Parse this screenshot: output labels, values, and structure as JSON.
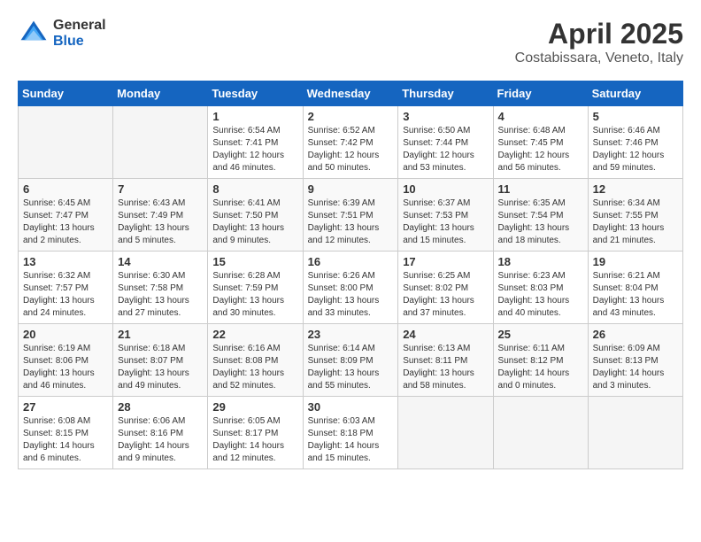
{
  "header": {
    "logo": {
      "general": "General",
      "blue": "Blue"
    },
    "title": "April 2025",
    "subtitle": "Costabissara, Veneto, Italy"
  },
  "weekdays": [
    "Sunday",
    "Monday",
    "Tuesday",
    "Wednesday",
    "Thursday",
    "Friday",
    "Saturday"
  ],
  "weeks": [
    [
      null,
      null,
      {
        "day": 1,
        "sunrise": "6:54 AM",
        "sunset": "7:41 PM",
        "daylight": "12 hours and 46 minutes."
      },
      {
        "day": 2,
        "sunrise": "6:52 AM",
        "sunset": "7:42 PM",
        "daylight": "12 hours and 50 minutes."
      },
      {
        "day": 3,
        "sunrise": "6:50 AM",
        "sunset": "7:44 PM",
        "daylight": "12 hours and 53 minutes."
      },
      {
        "day": 4,
        "sunrise": "6:48 AM",
        "sunset": "7:45 PM",
        "daylight": "12 hours and 56 minutes."
      },
      {
        "day": 5,
        "sunrise": "6:46 AM",
        "sunset": "7:46 PM",
        "daylight": "12 hours and 59 minutes."
      }
    ],
    [
      {
        "day": 6,
        "sunrise": "6:45 AM",
        "sunset": "7:47 PM",
        "daylight": "13 hours and 2 minutes."
      },
      {
        "day": 7,
        "sunrise": "6:43 AM",
        "sunset": "7:49 PM",
        "daylight": "13 hours and 5 minutes."
      },
      {
        "day": 8,
        "sunrise": "6:41 AM",
        "sunset": "7:50 PM",
        "daylight": "13 hours and 9 minutes."
      },
      {
        "day": 9,
        "sunrise": "6:39 AM",
        "sunset": "7:51 PM",
        "daylight": "13 hours and 12 minutes."
      },
      {
        "day": 10,
        "sunrise": "6:37 AM",
        "sunset": "7:53 PM",
        "daylight": "13 hours and 15 minutes."
      },
      {
        "day": 11,
        "sunrise": "6:35 AM",
        "sunset": "7:54 PM",
        "daylight": "13 hours and 18 minutes."
      },
      {
        "day": 12,
        "sunrise": "6:34 AM",
        "sunset": "7:55 PM",
        "daylight": "13 hours and 21 minutes."
      }
    ],
    [
      {
        "day": 13,
        "sunrise": "6:32 AM",
        "sunset": "7:57 PM",
        "daylight": "13 hours and 24 minutes."
      },
      {
        "day": 14,
        "sunrise": "6:30 AM",
        "sunset": "7:58 PM",
        "daylight": "13 hours and 27 minutes."
      },
      {
        "day": 15,
        "sunrise": "6:28 AM",
        "sunset": "7:59 PM",
        "daylight": "13 hours and 30 minutes."
      },
      {
        "day": 16,
        "sunrise": "6:26 AM",
        "sunset": "8:00 PM",
        "daylight": "13 hours and 33 minutes."
      },
      {
        "day": 17,
        "sunrise": "6:25 AM",
        "sunset": "8:02 PM",
        "daylight": "13 hours and 37 minutes."
      },
      {
        "day": 18,
        "sunrise": "6:23 AM",
        "sunset": "8:03 PM",
        "daylight": "13 hours and 40 minutes."
      },
      {
        "day": 19,
        "sunrise": "6:21 AM",
        "sunset": "8:04 PM",
        "daylight": "13 hours and 43 minutes."
      }
    ],
    [
      {
        "day": 20,
        "sunrise": "6:19 AM",
        "sunset": "8:06 PM",
        "daylight": "13 hours and 46 minutes."
      },
      {
        "day": 21,
        "sunrise": "6:18 AM",
        "sunset": "8:07 PM",
        "daylight": "13 hours and 49 minutes."
      },
      {
        "day": 22,
        "sunrise": "6:16 AM",
        "sunset": "8:08 PM",
        "daylight": "13 hours and 52 minutes."
      },
      {
        "day": 23,
        "sunrise": "6:14 AM",
        "sunset": "8:09 PM",
        "daylight": "13 hours and 55 minutes."
      },
      {
        "day": 24,
        "sunrise": "6:13 AM",
        "sunset": "8:11 PM",
        "daylight": "13 hours and 58 minutes."
      },
      {
        "day": 25,
        "sunrise": "6:11 AM",
        "sunset": "8:12 PM",
        "daylight": "14 hours and 0 minutes."
      },
      {
        "day": 26,
        "sunrise": "6:09 AM",
        "sunset": "8:13 PM",
        "daylight": "14 hours and 3 minutes."
      }
    ],
    [
      {
        "day": 27,
        "sunrise": "6:08 AM",
        "sunset": "8:15 PM",
        "daylight": "14 hours and 6 minutes."
      },
      {
        "day": 28,
        "sunrise": "6:06 AM",
        "sunset": "8:16 PM",
        "daylight": "14 hours and 9 minutes."
      },
      {
        "day": 29,
        "sunrise": "6:05 AM",
        "sunset": "8:17 PM",
        "daylight": "14 hours and 12 minutes."
      },
      {
        "day": 30,
        "sunrise": "6:03 AM",
        "sunset": "8:18 PM",
        "daylight": "14 hours and 15 minutes."
      },
      null,
      null,
      null
    ]
  ]
}
